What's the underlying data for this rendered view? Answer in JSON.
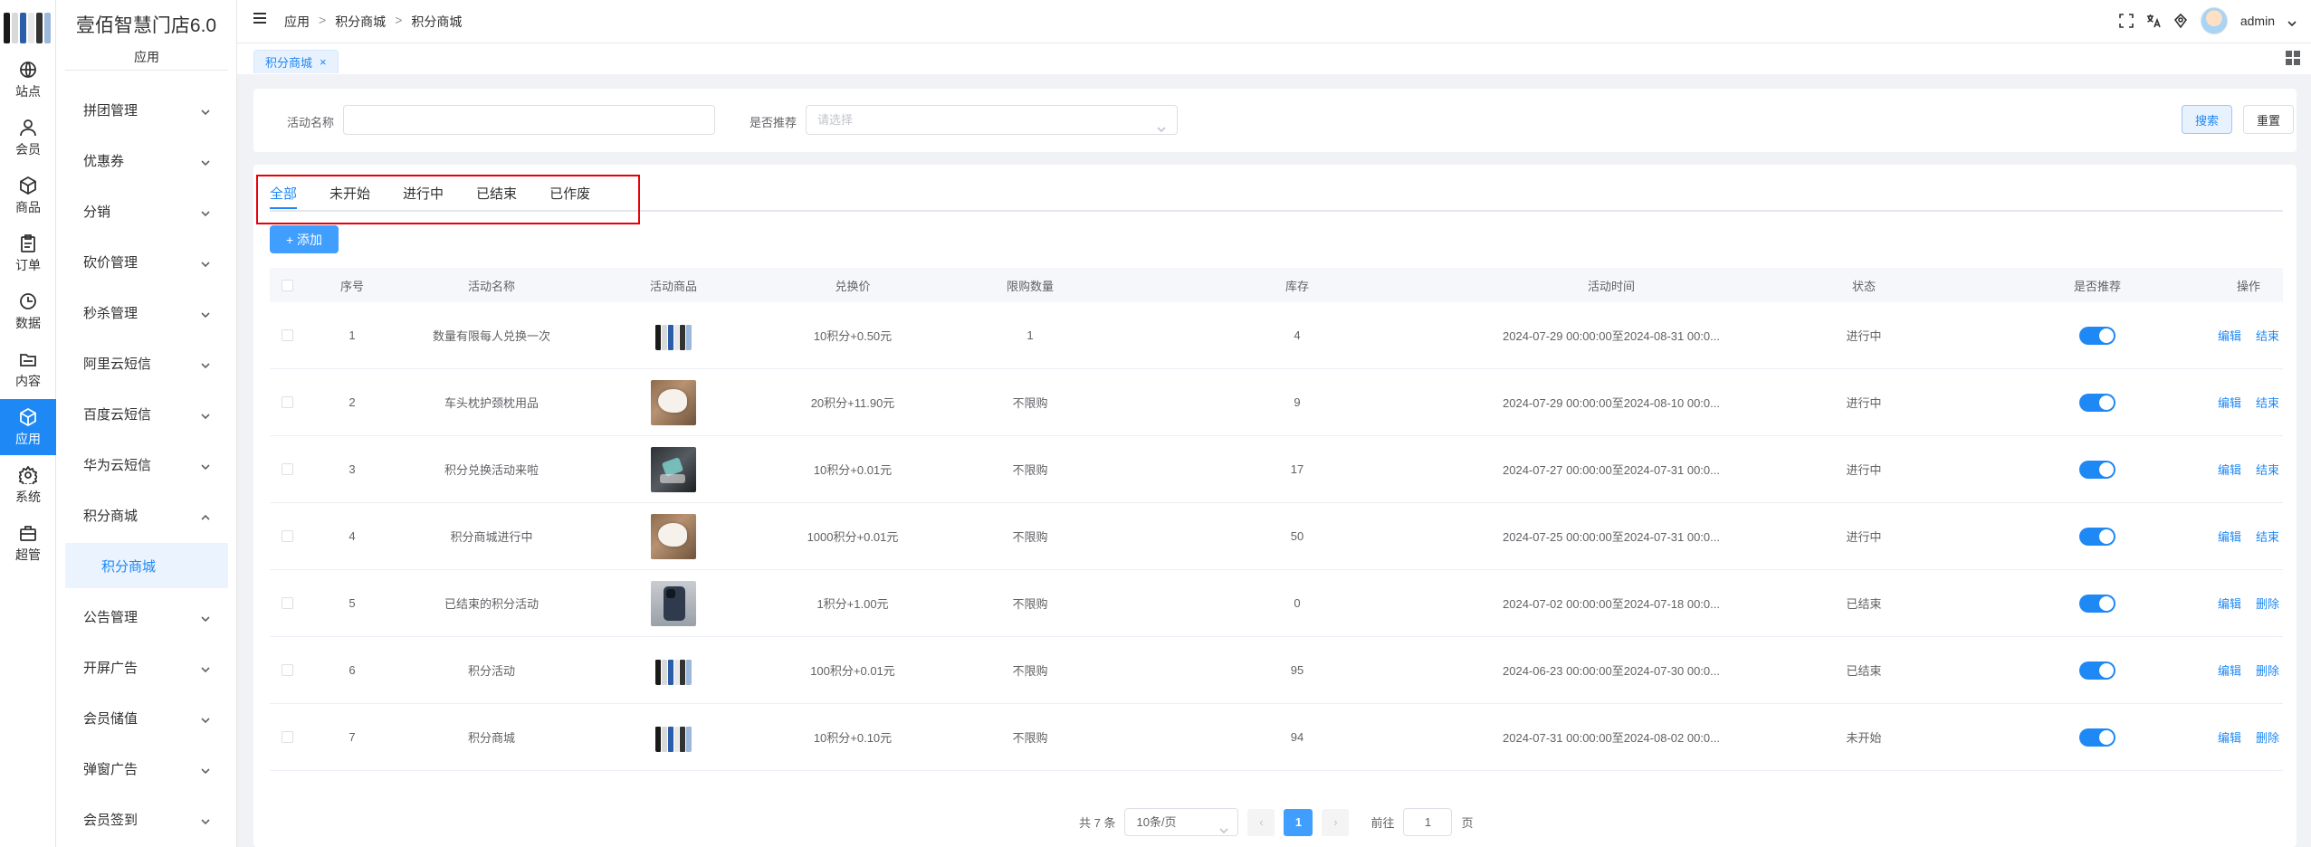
{
  "app": {
    "title": "壹佰智慧门店6.0"
  },
  "rail": [
    {
      "label": "站点",
      "icon": "globe-icon"
    },
    {
      "label": "会员",
      "icon": "user-icon"
    },
    {
      "label": "商品",
      "icon": "cube-icon"
    },
    {
      "label": "订单",
      "icon": "clipboard-icon"
    },
    {
      "label": "数据",
      "icon": "clock-icon"
    },
    {
      "label": "内容",
      "icon": "folder-icon"
    },
    {
      "label": "应用",
      "icon": "cube-icon",
      "active": true
    },
    {
      "label": "系统",
      "icon": "gear-icon"
    },
    {
      "label": "超管",
      "icon": "briefcase-icon"
    }
  ],
  "menu": {
    "section": "应用",
    "items": [
      {
        "label": "拼团管理",
        "expanded": false
      },
      {
        "label": "优惠券",
        "expanded": false
      },
      {
        "label": "分销",
        "expanded": false
      },
      {
        "label": "砍价管理",
        "expanded": false
      },
      {
        "label": "秒杀管理",
        "expanded": false
      },
      {
        "label": "阿里云短信",
        "expanded": false
      },
      {
        "label": "百度云短信",
        "expanded": false
      },
      {
        "label": "华为云短信",
        "expanded": false
      },
      {
        "label": "积分商城",
        "expanded": true
      },
      {
        "label": "积分商城",
        "child": true
      },
      {
        "label": "公告管理",
        "expanded": false
      },
      {
        "label": "开屏广告",
        "expanded": false
      },
      {
        "label": "会员储值",
        "expanded": false
      },
      {
        "label": "弹窗广告",
        "expanded": false
      },
      {
        "label": "会员签到",
        "expanded": false
      }
    ]
  },
  "header": {
    "breadcrumb": [
      "应用",
      "积分商城",
      "积分商城"
    ],
    "breadcrumb_sep": ">",
    "user": "admin"
  },
  "tab": {
    "label": "积分商城",
    "close": "×"
  },
  "search": {
    "name_label": "活动名称",
    "name_value": "",
    "recommend_label": "是否推荐",
    "recommend_placeholder": "请选择",
    "search_btn": "搜索",
    "reset_btn": "重置"
  },
  "status_tabs": [
    "全部",
    "未开始",
    "进行中",
    "已结束",
    "已作废"
  ],
  "add_btn": "+ 添加",
  "table": {
    "columns": [
      "序号",
      "活动名称",
      "活动商品",
      "兑换价",
      "限购数量",
      "库存",
      "活动时间",
      "状态",
      "是否推荐",
      "操作"
    ],
    "rows": [
      {
        "idx": "1",
        "name": "数量有限每人兑换一次",
        "img": "phones",
        "price": "10积分+0.50元",
        "limit": "1",
        "stock": "4",
        "time": "2024-07-29 00:00:00至2024-08-31 00:0...",
        "status": "进行中",
        "recommend": true,
        "ops": [
          "编辑",
          "结束"
        ]
      },
      {
        "idx": "2",
        "name": "车头枕护颈枕用品",
        "img": "pillow",
        "price": "20积分+11.90元",
        "limit": "不限购",
        "stock": "9",
        "time": "2024-07-29 00:00:00至2024-08-10 00:0...",
        "status": "进行中",
        "recommend": true,
        "ops": [
          "编辑",
          "结束"
        ]
      },
      {
        "idx": "3",
        "name": "积分兑换活动来啦",
        "img": "dark",
        "price": "10积分+0.01元",
        "limit": "不限购",
        "stock": "17",
        "time": "2024-07-27 00:00:00至2024-07-31 00:0...",
        "status": "进行中",
        "recommend": true,
        "ops": [
          "编辑",
          "结束"
        ]
      },
      {
        "idx": "4",
        "name": "积分商城进行中",
        "img": "pillow",
        "price": "1000积分+0.01元",
        "limit": "不限购",
        "stock": "50",
        "time": "2024-07-25 00:00:00至2024-07-31 00:0...",
        "status": "进行中",
        "recommend": true,
        "ops": [
          "编辑",
          "结束"
        ]
      },
      {
        "idx": "5",
        "name": "已结束的积分活动",
        "img": "iphone",
        "price": "1积分+1.00元",
        "limit": "不限购",
        "stock": "0",
        "time": "2024-07-02 00:00:00至2024-07-18 00:0...",
        "status": "已结束",
        "recommend": true,
        "ops": [
          "编辑",
          "删除"
        ]
      },
      {
        "idx": "6",
        "name": "积分活动",
        "img": "phones",
        "price": "100积分+0.01元",
        "limit": "不限购",
        "stock": "95",
        "time": "2024-06-23 00:00:00至2024-07-30 00:0...",
        "status": "已结束",
        "recommend": true,
        "ops": [
          "编辑",
          "删除"
        ]
      },
      {
        "idx": "7",
        "name": "积分商城",
        "img": "phones",
        "price": "10积分+0.10元",
        "limit": "不限购",
        "stock": "94",
        "time": "2024-07-31 00:00:00至2024-08-02 00:0...",
        "status": "未开始",
        "recommend": true,
        "ops": [
          "编辑",
          "删除"
        ]
      }
    ]
  },
  "pagination": {
    "total": "共 7 条",
    "page_size": "10条/页",
    "prev": "‹",
    "current": "1",
    "next": "›",
    "goto_label": "前往",
    "goto_value": "1",
    "page_suffix": "页"
  },
  "colors": {
    "accent": "#1e88f5",
    "highlight_box": "#e8000b"
  }
}
